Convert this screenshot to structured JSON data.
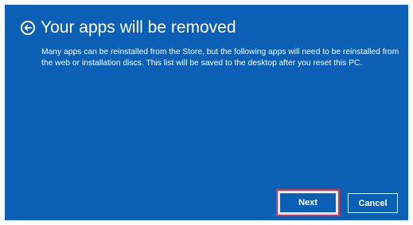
{
  "header": {
    "back_icon": "back-arrow-circle-icon",
    "title": "Your apps will be removed"
  },
  "body": {
    "description": "Many apps can be reinstalled from the Store, but the following apps will need to be reinstalled from the web or installation discs. This list will be saved to the desktop after you reset this PC."
  },
  "buttons": {
    "next_label": "Next",
    "cancel_label": "Cancel"
  },
  "colors": {
    "background": "#0b5fb4",
    "text": "#ffffff",
    "highlight_border": "#d9364a"
  }
}
